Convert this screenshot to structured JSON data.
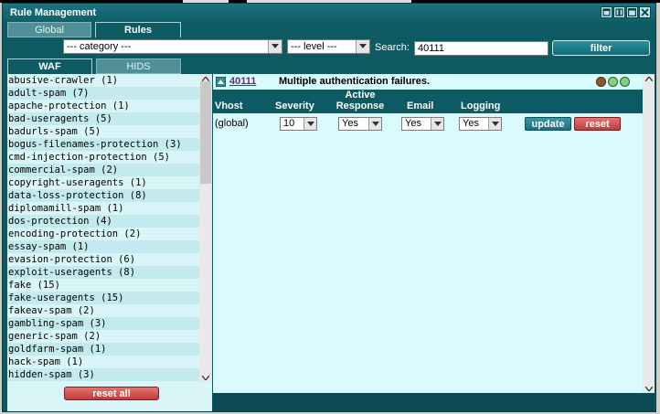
{
  "window": {
    "title": "Rule Management",
    "controls": [
      "restore-icon",
      "tile-icon",
      "maximize-icon",
      "close-icon"
    ]
  },
  "tabs": [
    {
      "label": "Global",
      "active": false
    },
    {
      "label": "Rules",
      "active": true
    }
  ],
  "filters": {
    "category": "--- category ---",
    "level": "--- level ---",
    "search_label": "Search:",
    "search_value": "40111",
    "filter_label": "filter"
  },
  "sub_tabs": [
    {
      "label": "WAF",
      "active": true
    },
    {
      "label": "HIDS",
      "active": false
    }
  ],
  "categories": [
    "abusive-crawler (1)",
    "adult-spam (7)",
    "apache-protection (1)",
    "bad-useragents (5)",
    "badurls-spam (5)",
    "bogus-filenames-protection (3)",
    "cmd-injection-protection (5)",
    "commercial-spam (2)",
    "copyright-useragents (1)",
    "data-loss-protection (8)",
    "diplomamill-spam (1)",
    "dos-protection (4)",
    "encoding-protection (2)",
    "essay-spam (1)",
    "evasion-protection (6)",
    "exploit-useragents (8)",
    "fake (15)",
    "fake-useragents (15)",
    "fakeav-spam (2)",
    "gambling-spam (3)",
    "generic-spam (2)",
    "goldfarm-spam (1)",
    "hack-spam (1)",
    "hidden-spam (3)"
  ],
  "reset_all_label": "reset all",
  "rule": {
    "id": "40111",
    "description": "Multiple authentication failures.",
    "headers": {
      "vhost": "Vhost",
      "severity": "Severity",
      "active_response_1": "Active",
      "active_response_2": "Response",
      "email": "Email",
      "logging": "Logging"
    },
    "row": {
      "vhost": "(global)",
      "severity": "10",
      "active_response": "Yes",
      "email": "Yes",
      "logging": "Yes"
    },
    "update_label": "update",
    "reset_label": "reset"
  },
  "colors": {
    "window_bg": "#0e5a63",
    "list_bg": "#daf5f8",
    "detail_bg": "#d9fbfd",
    "reset_red": "#c23b3b"
  }
}
